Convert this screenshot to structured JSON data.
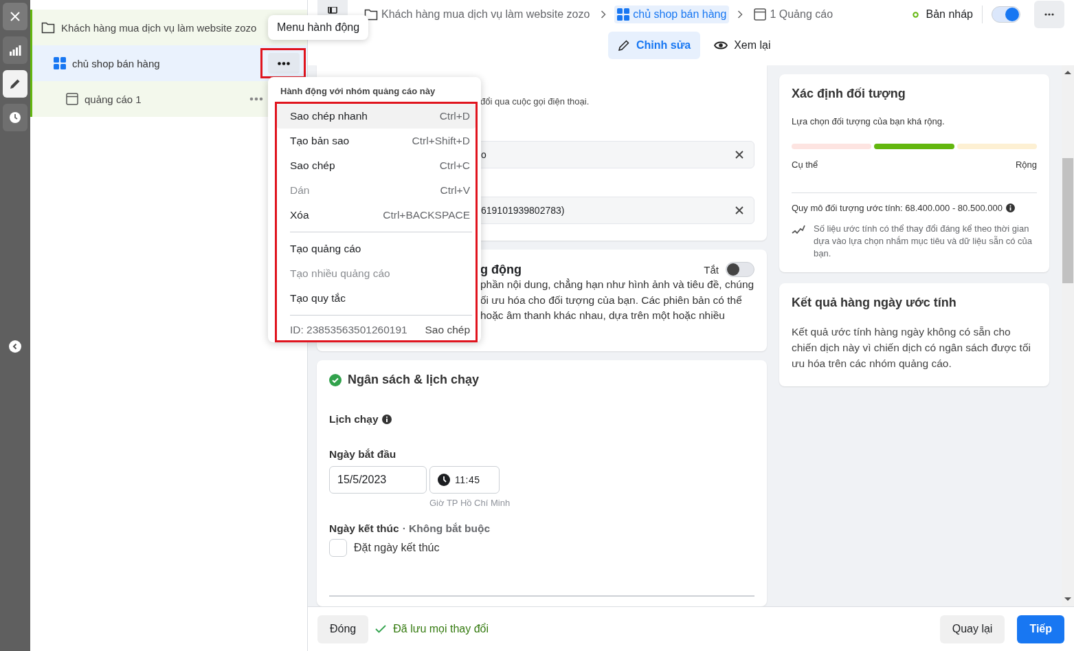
{
  "rail": {
    "items": [
      {
        "kind": "close",
        "selected": false
      },
      {
        "kind": "chart",
        "selected": false
      },
      {
        "kind": "edit",
        "selected": true
      },
      {
        "kind": "history",
        "selected": false
      }
    ]
  },
  "tree": [
    {
      "kind": "campaign",
      "label": "Khách hàng mua dịch vụ làm website zozo",
      "selected": false,
      "more_visible": false,
      "children": [
        {
          "kind": "adset",
          "label": "chủ shop bán hàng",
          "selected": true,
          "more_visible": true,
          "menu_open": true,
          "highlight": true,
          "children": [
            {
              "kind": "ad",
              "label": "quảng cáo 1",
              "selected": false,
              "more_visible": true
            }
          ]
        }
      ]
    }
  ],
  "tooltip": {
    "text": "Menu hành động"
  },
  "menu": {
    "title": "Hành động với nhóm quảng cáo này",
    "highlight": true,
    "sections": [
      {
        "items": [
          {
            "label": "Sao chép nhanh",
            "shortcut": "Ctrl+D",
            "disabled": false,
            "hovered": true
          },
          {
            "label": "Tạo bản sao",
            "shortcut": "Ctrl+Shift+D",
            "disabled": false,
            "hovered": false
          },
          {
            "label": "Sao chép",
            "shortcut": "Ctrl+C",
            "disabled": false,
            "hovered": false
          },
          {
            "label": "Dán",
            "shortcut": "Ctrl+V",
            "disabled": true,
            "hovered": false
          },
          {
            "label": "Xóa",
            "shortcut": "Ctrl+BACKSPACE",
            "disabled": false,
            "hovered": false
          }
        ]
      },
      {
        "items": [
          {
            "label": "Tạo quảng cáo",
            "disabled": false,
            "hovered": false
          },
          {
            "label": "Tạo nhiều quảng cáo",
            "disabled": true,
            "hovered": false
          },
          {
            "label": "Tạo quy tắc",
            "disabled": false,
            "hovered": false
          }
        ]
      }
    ],
    "id_text": "ID: 23853563501260191",
    "copy_link": "Sao chép"
  },
  "breadcrumb": [
    {
      "kind": "campaign",
      "label": "Khách hàng mua dịch vụ làm website zozo",
      "selected": false
    },
    {
      "kind": "adset",
      "label": "chủ shop bán hàng",
      "selected": true
    },
    {
      "kind": "ad",
      "label": "1 Quảng cáo",
      "selected": false
    }
  ],
  "status": {
    "label": "Bản nháp",
    "on": true
  },
  "tabs": [
    {
      "kind": "edit",
      "label": "Chỉnh sửa",
      "selected": true
    },
    {
      "kind": "review",
      "label": "Xem lại",
      "selected": false
    }
  ],
  "identity_card": {
    "note": "đổi qua cuộc gọi điện thoại.",
    "fields": [
      {
        "value": "o"
      },
      {
        "value": "619101939802783)"
      }
    ]
  },
  "creative_card": {
    "title": "g động",
    "toggle": {
      "label": "Tắt",
      "on": false
    },
    "lines": [
      "phần nội dung, chẳng hạn như hình ảnh và tiêu đề, chúng",
      "ối ưu hóa cho đối tượng của bạn. Các phiên bản có thể",
      "hoặc âm thanh khác nhau, dựa trên một hoặc nhiều"
    ]
  },
  "budget_card": {
    "title": "Ngân sách & lịch chạy",
    "complete": true,
    "schedule_label": "Lịch chạy",
    "start_label": "Ngày bắt đầu",
    "start_date": "15/5/2023",
    "start_time": "11:45",
    "timezone": "Giờ TP Hồ Chí Minh",
    "end_label": "Ngày kết thúc",
    "end_optional": "· Không bắt buộc",
    "end_checkbox": {
      "label": "Đặt ngày kết thúc",
      "checked": false
    }
  },
  "audience_card": {
    "title": "Xác định đối tượng",
    "summary": "Lựa chọn đối tượng của bạn khá rộng.",
    "meter": [
      {
        "color": "#fde4e1"
      },
      {
        "color": "#63b70f"
      },
      {
        "color": "#fdf0d3"
      }
    ],
    "min_label": "Cụ thể",
    "max_label": "Rộng",
    "size": "Quy mô đối tượng ước tính: 68.400.000 - 80.500.000",
    "note": "Số liệu ước tính có thể thay đổi đáng kể theo thời gian dựa vào lựa chọn nhắm mục tiêu và dữ liệu sẵn có của bạn."
  },
  "results_card": {
    "title": "Kết quả hàng ngày ước tính",
    "text": "Kết quả ước tính hàng ngày không có sẵn cho chiến dịch này vì chiến dịch có ngân sách được tối ưu hóa trên các nhóm quảng cáo."
  },
  "footer": {
    "close": "Đóng",
    "saved": "Đã lưu mọi thay đổi",
    "back": "Quay lại",
    "next": "Tiếp"
  }
}
